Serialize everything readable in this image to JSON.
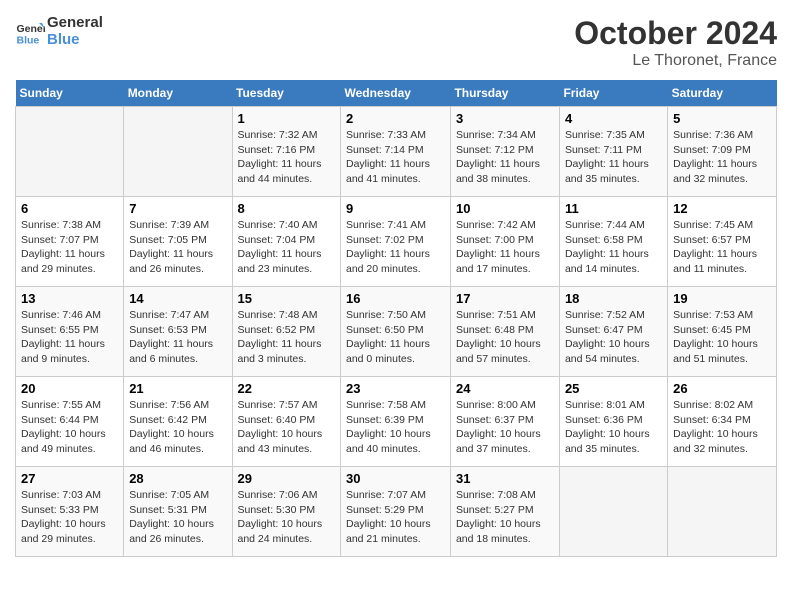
{
  "header": {
    "logo_line1": "General",
    "logo_line2": "Blue",
    "month": "October 2024",
    "location": "Le Thoronet, France"
  },
  "weekdays": [
    "Sunday",
    "Monday",
    "Tuesday",
    "Wednesday",
    "Thursday",
    "Friday",
    "Saturday"
  ],
  "weeks": [
    [
      {
        "day": "",
        "sunrise": "",
        "sunset": "",
        "daylight": ""
      },
      {
        "day": "",
        "sunrise": "",
        "sunset": "",
        "daylight": ""
      },
      {
        "day": "1",
        "sunrise": "Sunrise: 7:32 AM",
        "sunset": "Sunset: 7:16 PM",
        "daylight": "Daylight: 11 hours and 44 minutes."
      },
      {
        "day": "2",
        "sunrise": "Sunrise: 7:33 AM",
        "sunset": "Sunset: 7:14 PM",
        "daylight": "Daylight: 11 hours and 41 minutes."
      },
      {
        "day": "3",
        "sunrise": "Sunrise: 7:34 AM",
        "sunset": "Sunset: 7:12 PM",
        "daylight": "Daylight: 11 hours and 38 minutes."
      },
      {
        "day": "4",
        "sunrise": "Sunrise: 7:35 AM",
        "sunset": "Sunset: 7:11 PM",
        "daylight": "Daylight: 11 hours and 35 minutes."
      },
      {
        "day": "5",
        "sunrise": "Sunrise: 7:36 AM",
        "sunset": "Sunset: 7:09 PM",
        "daylight": "Daylight: 11 hours and 32 minutes."
      }
    ],
    [
      {
        "day": "6",
        "sunrise": "Sunrise: 7:38 AM",
        "sunset": "Sunset: 7:07 PM",
        "daylight": "Daylight: 11 hours and 29 minutes."
      },
      {
        "day": "7",
        "sunrise": "Sunrise: 7:39 AM",
        "sunset": "Sunset: 7:05 PM",
        "daylight": "Daylight: 11 hours and 26 minutes."
      },
      {
        "day": "8",
        "sunrise": "Sunrise: 7:40 AM",
        "sunset": "Sunset: 7:04 PM",
        "daylight": "Daylight: 11 hours and 23 minutes."
      },
      {
        "day": "9",
        "sunrise": "Sunrise: 7:41 AM",
        "sunset": "Sunset: 7:02 PM",
        "daylight": "Daylight: 11 hours and 20 minutes."
      },
      {
        "day": "10",
        "sunrise": "Sunrise: 7:42 AM",
        "sunset": "Sunset: 7:00 PM",
        "daylight": "Daylight: 11 hours and 17 minutes."
      },
      {
        "day": "11",
        "sunrise": "Sunrise: 7:44 AM",
        "sunset": "Sunset: 6:58 PM",
        "daylight": "Daylight: 11 hours and 14 minutes."
      },
      {
        "day": "12",
        "sunrise": "Sunrise: 7:45 AM",
        "sunset": "Sunset: 6:57 PM",
        "daylight": "Daylight: 11 hours and 11 minutes."
      }
    ],
    [
      {
        "day": "13",
        "sunrise": "Sunrise: 7:46 AM",
        "sunset": "Sunset: 6:55 PM",
        "daylight": "Daylight: 11 hours and 9 minutes."
      },
      {
        "day": "14",
        "sunrise": "Sunrise: 7:47 AM",
        "sunset": "Sunset: 6:53 PM",
        "daylight": "Daylight: 11 hours and 6 minutes."
      },
      {
        "day": "15",
        "sunrise": "Sunrise: 7:48 AM",
        "sunset": "Sunset: 6:52 PM",
        "daylight": "Daylight: 11 hours and 3 minutes."
      },
      {
        "day": "16",
        "sunrise": "Sunrise: 7:50 AM",
        "sunset": "Sunset: 6:50 PM",
        "daylight": "Daylight: 11 hours and 0 minutes."
      },
      {
        "day": "17",
        "sunrise": "Sunrise: 7:51 AM",
        "sunset": "Sunset: 6:48 PM",
        "daylight": "Daylight: 10 hours and 57 minutes."
      },
      {
        "day": "18",
        "sunrise": "Sunrise: 7:52 AM",
        "sunset": "Sunset: 6:47 PM",
        "daylight": "Daylight: 10 hours and 54 minutes."
      },
      {
        "day": "19",
        "sunrise": "Sunrise: 7:53 AM",
        "sunset": "Sunset: 6:45 PM",
        "daylight": "Daylight: 10 hours and 51 minutes."
      }
    ],
    [
      {
        "day": "20",
        "sunrise": "Sunrise: 7:55 AM",
        "sunset": "Sunset: 6:44 PM",
        "daylight": "Daylight: 10 hours and 49 minutes."
      },
      {
        "day": "21",
        "sunrise": "Sunrise: 7:56 AM",
        "sunset": "Sunset: 6:42 PM",
        "daylight": "Daylight: 10 hours and 46 minutes."
      },
      {
        "day": "22",
        "sunrise": "Sunrise: 7:57 AM",
        "sunset": "Sunset: 6:40 PM",
        "daylight": "Daylight: 10 hours and 43 minutes."
      },
      {
        "day": "23",
        "sunrise": "Sunrise: 7:58 AM",
        "sunset": "Sunset: 6:39 PM",
        "daylight": "Daylight: 10 hours and 40 minutes."
      },
      {
        "day": "24",
        "sunrise": "Sunrise: 8:00 AM",
        "sunset": "Sunset: 6:37 PM",
        "daylight": "Daylight: 10 hours and 37 minutes."
      },
      {
        "day": "25",
        "sunrise": "Sunrise: 8:01 AM",
        "sunset": "Sunset: 6:36 PM",
        "daylight": "Daylight: 10 hours and 35 minutes."
      },
      {
        "day": "26",
        "sunrise": "Sunrise: 8:02 AM",
        "sunset": "Sunset: 6:34 PM",
        "daylight": "Daylight: 10 hours and 32 minutes."
      }
    ],
    [
      {
        "day": "27",
        "sunrise": "Sunrise: 7:03 AM",
        "sunset": "Sunset: 5:33 PM",
        "daylight": "Daylight: 10 hours and 29 minutes."
      },
      {
        "day": "28",
        "sunrise": "Sunrise: 7:05 AM",
        "sunset": "Sunset: 5:31 PM",
        "daylight": "Daylight: 10 hours and 26 minutes."
      },
      {
        "day": "29",
        "sunrise": "Sunrise: 7:06 AM",
        "sunset": "Sunset: 5:30 PM",
        "daylight": "Daylight: 10 hours and 24 minutes."
      },
      {
        "day": "30",
        "sunrise": "Sunrise: 7:07 AM",
        "sunset": "Sunset: 5:29 PM",
        "daylight": "Daylight: 10 hours and 21 minutes."
      },
      {
        "day": "31",
        "sunrise": "Sunrise: 7:08 AM",
        "sunset": "Sunset: 5:27 PM",
        "daylight": "Daylight: 10 hours and 18 minutes."
      },
      {
        "day": "",
        "sunrise": "",
        "sunset": "",
        "daylight": ""
      },
      {
        "day": "",
        "sunrise": "",
        "sunset": "",
        "daylight": ""
      }
    ]
  ]
}
